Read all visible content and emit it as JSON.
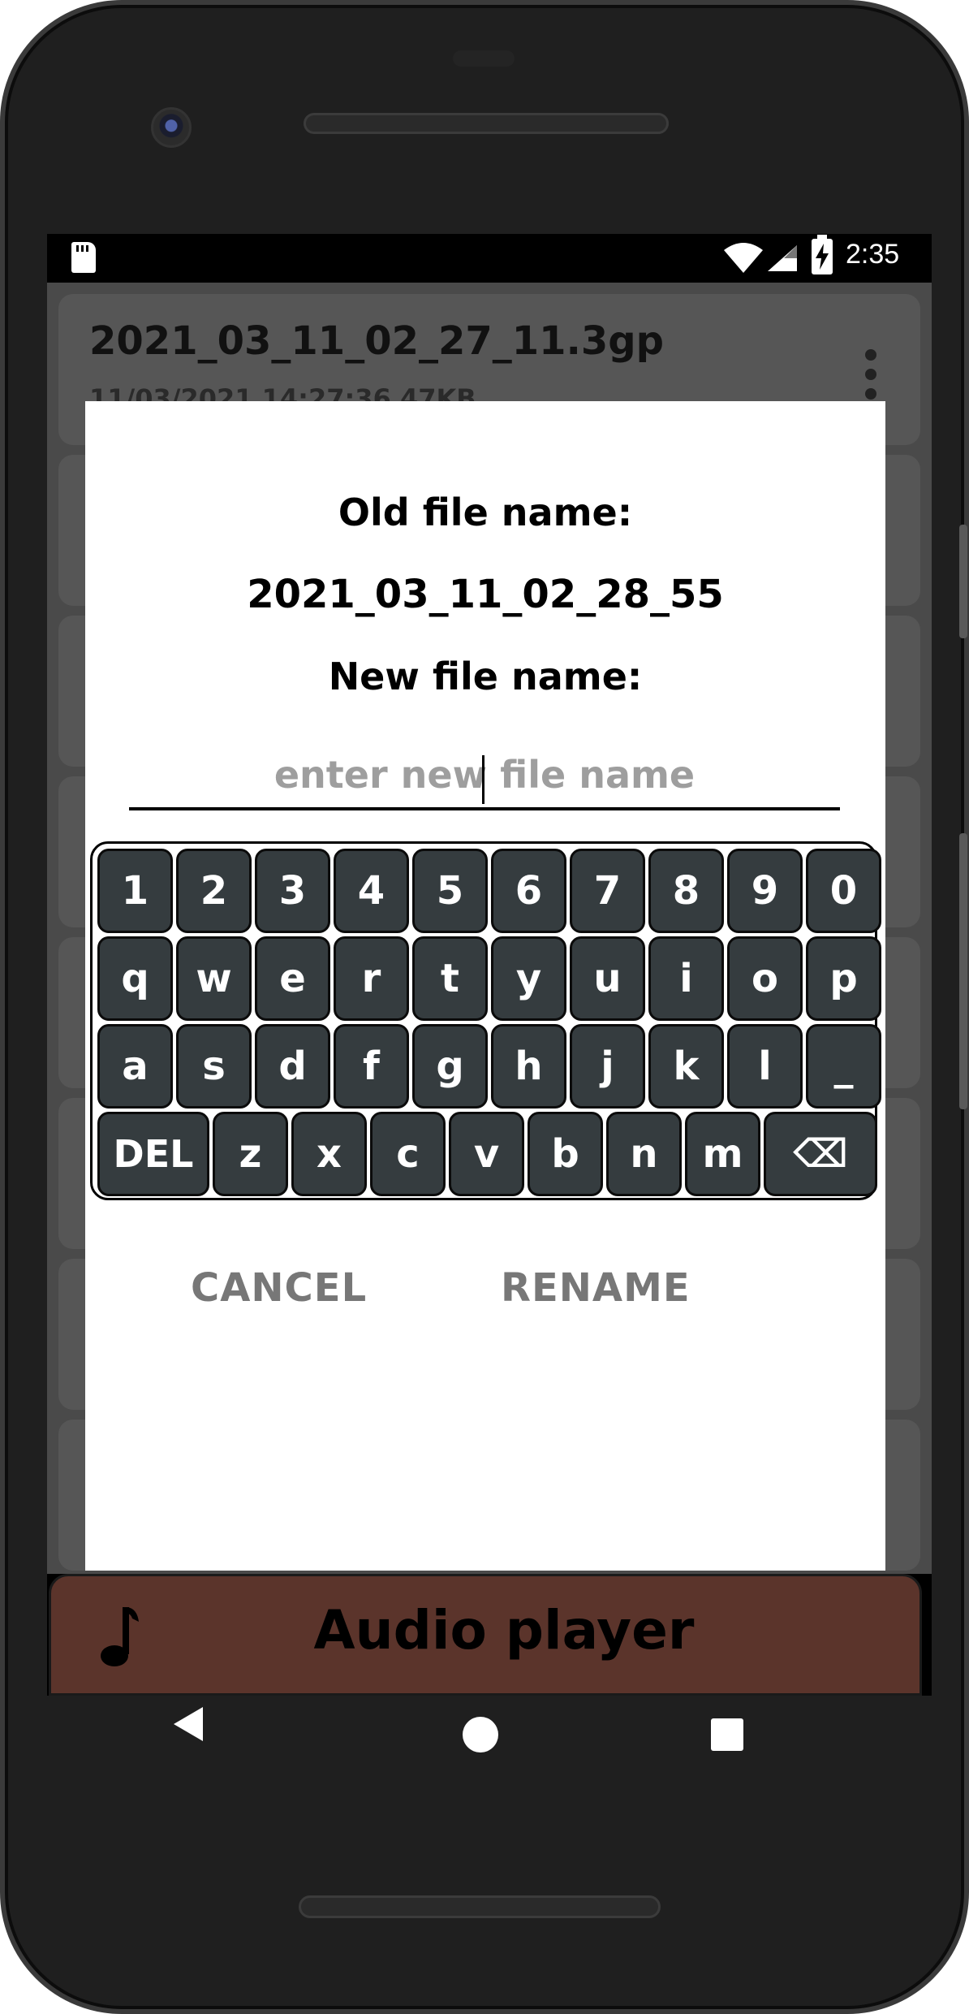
{
  "status_bar": {
    "time": "2:35",
    "icons": [
      "sd-card-icon",
      "wifi-icon",
      "signal-icon",
      "battery-charging-icon"
    ]
  },
  "background_list": {
    "items": [
      {
        "title": "2021_03_11_02_27_11.3gp",
        "meta": "11/03/2021 14:27:36 47KB"
      }
    ]
  },
  "dialog": {
    "old_label": "Old file name:",
    "old_value": "2021_03_11_02_28_55",
    "new_label": "New file name:",
    "input_value": "",
    "input_placeholder": "enter new file name",
    "cancel_label": "CANCEL",
    "rename_label": "RENAME"
  },
  "keyboard": {
    "row1": [
      "1",
      "2",
      "3",
      "4",
      "5",
      "6",
      "7",
      "8",
      "9",
      "0"
    ],
    "row2": [
      "q",
      "w",
      "e",
      "r",
      "t",
      "y",
      "u",
      "i",
      "o",
      "p"
    ],
    "row3": [
      "a",
      "s",
      "d",
      "f",
      "g",
      "h",
      "j",
      "k",
      "l",
      "_"
    ],
    "row4": [
      "DEL",
      "z",
      "x",
      "c",
      "v",
      "b",
      "n",
      "m",
      "⌫"
    ]
  },
  "player": {
    "title": "Audio player",
    "icon": "music-note-icon",
    "color": "#5b342b"
  },
  "nav": {
    "icons": [
      "back-icon",
      "home-icon",
      "recents-icon"
    ]
  }
}
